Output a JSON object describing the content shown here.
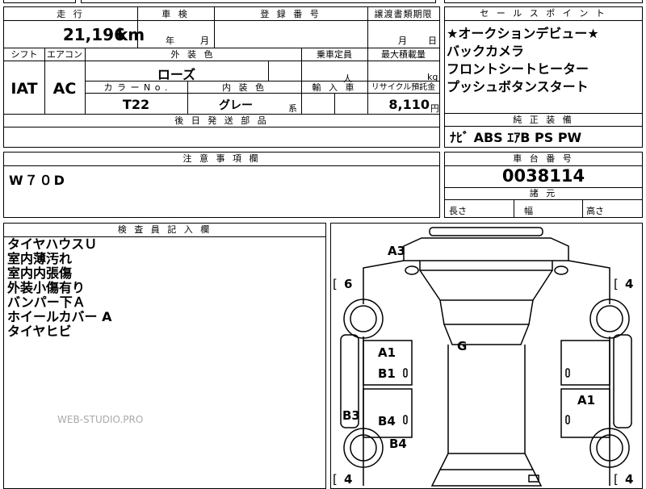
{
  "top_row": {
    "headers": {
      "mileage": "走 行",
      "inspection": "車 検",
      "registration": "登 録 番 号",
      "transfer": "譲渡書類期限"
    },
    "mileage_value": "21,196",
    "mileage_unit": "km",
    "insp_year": "年",
    "insp_month": "月",
    "transfer_month": "月",
    "transfer_day": "日"
  },
  "second_row": {
    "headers": {
      "shift": "シフト",
      "ac": "エアコン",
      "exterior": "外 装 色",
      "capacity": "乗車定員",
      "load": "最大積載量"
    },
    "shift_value": "IAT",
    "ac_value": "AC",
    "exterior_value": "ローズ",
    "capacity_unit": "人",
    "load_unit": "kg",
    "sub_headers": {
      "color_no": "カ ラ ー N o .",
      "interior": "内 装 色",
      "import": "輸 入 車",
      "recycle": "リサイクル預託金"
    },
    "color_no_value": "T22",
    "interior_value": "グレー",
    "interior_suffix": "系",
    "recycle_value": "8,110",
    "recycle_unit": "円",
    "later_parts_header": "後 日 発 送 部 品"
  },
  "sales_points": {
    "header": "セ ー ル ス ポ イ ン ト",
    "lines": [
      "★オークションデビュー★",
      "バックカメラ",
      "フロントシートヒーター",
      "プッシュボタンスタート"
    ]
  },
  "standard_equipment": {
    "header": "純 正 装 備",
    "value": "ﾅﾋﾞ ABS ｴｱB PS PW"
  },
  "notes": {
    "header": "注 意 事 項 欄",
    "value": "W７０D"
  },
  "chassis": {
    "header": "車 台 番 号",
    "value": "0038114",
    "spec_header": "諸 元",
    "length_label": "長さ",
    "width_label": "幅",
    "height_label": "高さ"
  },
  "inspector": {
    "header": "検 査 員 記 入 欄",
    "lines": [
      "タイヤハウスＵ",
      "室内薄汚れ",
      "室内内張傷",
      "外装小傷有り",
      "バンパー下Ａ",
      "ホイールカバー A",
      "タイヤヒビ"
    ]
  },
  "diagram": {
    "tire_left_top": "6",
    "tire_right_top": "4",
    "tire_left_bottom": "4",
    "tire_right_bottom": "4",
    "bracket_open": "[",
    "marks": {
      "a3": "A3",
      "g": "G",
      "a1_left": "A1",
      "b1_left": "B1",
      "a1_right": "A1",
      "b3": "B3",
      "b4_door": "B4",
      "b4_rear": "B4"
    }
  },
  "watermark": "WEB-STUDIO.PRO"
}
